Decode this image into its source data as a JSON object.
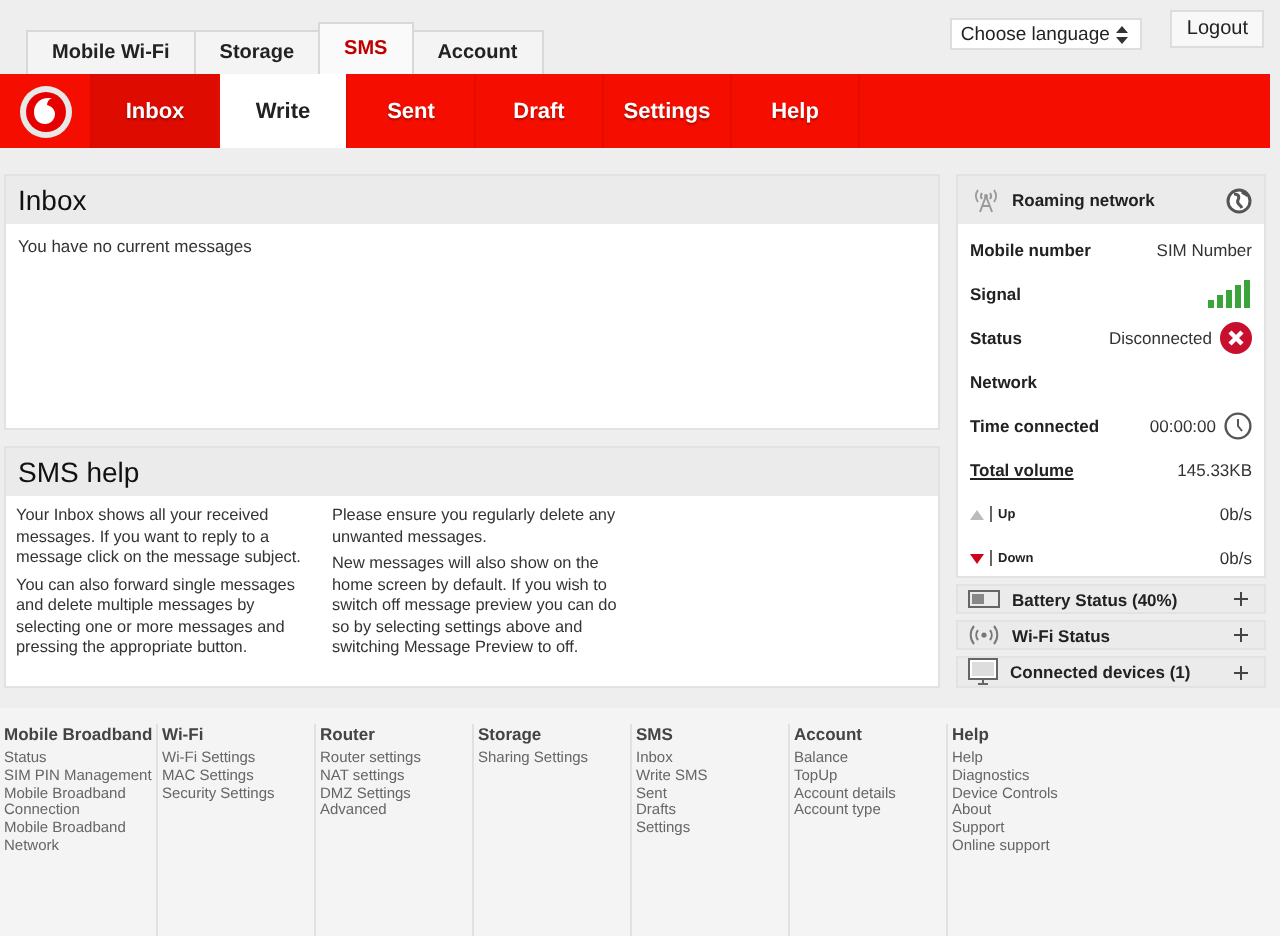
{
  "top_tabs": [
    {
      "label": "Mobile Wi-Fi",
      "selected": false
    },
    {
      "label": "Storage",
      "selected": false
    },
    {
      "label": "SMS",
      "selected": true
    },
    {
      "label": "Account",
      "selected": false
    }
  ],
  "language_select": {
    "value": "Choose language"
  },
  "logout_button": "Logout",
  "sub_nav": [
    {
      "label": "Inbox",
      "selected": false,
      "current": true
    },
    {
      "label": "Write",
      "selected": true,
      "current": false
    },
    {
      "label": "Sent",
      "selected": false,
      "current": false
    },
    {
      "label": "Draft",
      "selected": false,
      "current": false
    },
    {
      "label": "Settings",
      "selected": false,
      "current": false
    },
    {
      "label": "Help",
      "selected": false,
      "current": false
    }
  ],
  "inbox": {
    "title": "Inbox",
    "message": "You have no current messages"
  },
  "sms_help": {
    "title": "SMS help",
    "columns": [
      [
        "Your Inbox shows all your received messages. If you want to reply to a message click on the message subject.",
        "You can also forward single messages and delete multiple messages by selecting one or more messages and pressing the appropriate button."
      ],
      [
        "Please ensure you regularly delete any unwanted messages.",
        "New messages will also show on the home screen by default. If you wish to switch off message preview you can do so by selecting settings above and switching Message Preview to off."
      ]
    ]
  },
  "network_panel": {
    "title": "Roaming network",
    "rows": [
      {
        "kind": "text",
        "label": "Mobile number",
        "value": "SIM Number"
      },
      {
        "kind": "signal",
        "label": "Signal"
      },
      {
        "kind": "status",
        "label": "Status",
        "value": "Disconnected"
      },
      {
        "kind": "text",
        "label": "Network"
      },
      {
        "kind": "time",
        "label": "Time connected",
        "value": "00:00:00"
      },
      {
        "kind": "link",
        "label": "Total volume",
        "value": "145.33KB"
      },
      {
        "kind": "up",
        "label": "Up",
        "value": "0b/s"
      },
      {
        "kind": "down",
        "label": "Down",
        "value": "0b/s"
      }
    ]
  },
  "collapsed_panels": [
    {
      "kind": "battery",
      "title": "Battery Status (40%)",
      "expanded": false
    },
    {
      "kind": "wifi",
      "title": "Wi-Fi Status",
      "expanded": false
    },
    {
      "kind": "devices",
      "title": "Connected devices (1)",
      "expanded": false
    }
  ],
  "footer": [
    {
      "title": "Mobile Broadband",
      "links": [
        "Status",
        "SIM PIN Management",
        "Mobile Broadband Connection",
        "Mobile Broadband Network"
      ]
    },
    {
      "title": "Wi-Fi",
      "links": [
        "Wi-Fi Settings",
        "MAC Settings",
        "Security Settings"
      ]
    },
    {
      "title": "Router",
      "links": [
        "Router settings",
        "NAT settings",
        "DMZ Settings",
        "Advanced"
      ]
    },
    {
      "title": "Storage",
      "links": [
        "Sharing Settings"
      ]
    },
    {
      "title": "SMS",
      "links": [
        "Inbox",
        "Write SMS",
        "Sent",
        "Drafts",
        "Settings"
      ]
    },
    {
      "title": "Account",
      "links": [
        "Balance",
        "TopUp",
        "Account details",
        "Account type"
      ]
    },
    {
      "title": "Help",
      "links": [
        "Help",
        "Diagnostics",
        "Device Controls",
        "About",
        "Support",
        "Online support"
      ]
    }
  ]
}
